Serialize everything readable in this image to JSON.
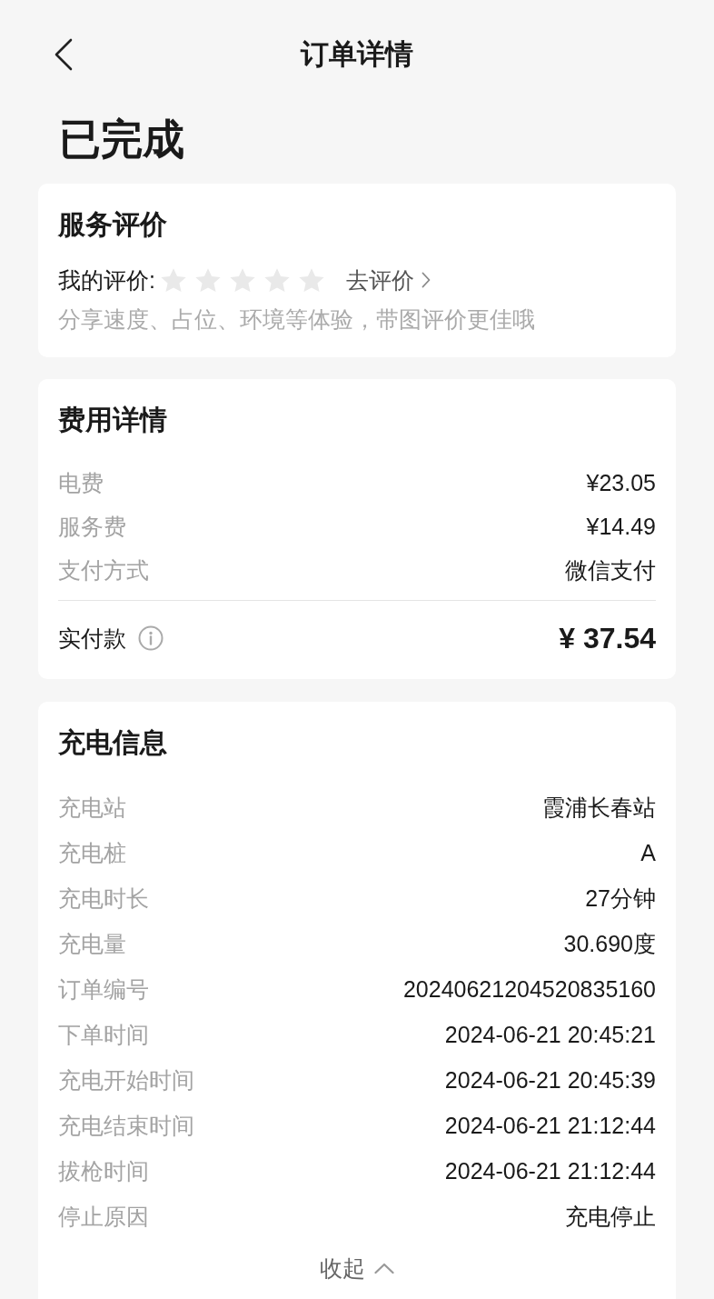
{
  "nav": {
    "title": "订单详情"
  },
  "status": "已完成",
  "rating_card": {
    "title": "服务评价",
    "label": "我的评价:",
    "stars": 0,
    "action": "去评价",
    "hint": "分享速度、占位、环境等体验，带图评价更佳哦"
  },
  "fee_card": {
    "title": "费用详情",
    "rows": [
      {
        "label": "电费",
        "value": "¥23.05"
      },
      {
        "label": "服务费",
        "value": "¥14.49"
      },
      {
        "label": "支付方式",
        "value": "微信支付"
      }
    ],
    "total": {
      "label": "实付款",
      "value": "¥ 37.54"
    }
  },
  "charging_card": {
    "title": "充电信息",
    "rows": [
      {
        "label": "充电站",
        "value": "霞浦长春站"
      },
      {
        "label": "充电桩",
        "value": "A"
      },
      {
        "label": "充电时长",
        "value": "27分钟"
      },
      {
        "label": "充电量",
        "value": "30.690度"
      },
      {
        "label": "订单编号",
        "value": "20240621204520835160"
      },
      {
        "label": "下单时间",
        "value": "2024-06-21 20:45:21"
      },
      {
        "label": "充电开始时间",
        "value": "2024-06-21 20:45:39"
      },
      {
        "label": "充电结束时间",
        "value": "2024-06-21 21:12:44"
      },
      {
        "label": "拔枪时间",
        "value": "2024-06-21 21:12:44"
      },
      {
        "label": "停止原因",
        "value": "充电停止"
      }
    ],
    "collapse": {
      "label": "收起",
      "expanded": true
    }
  }
}
